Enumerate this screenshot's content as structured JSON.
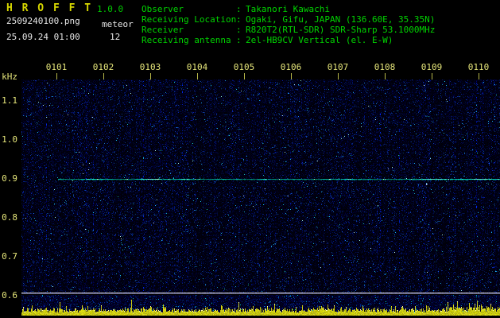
{
  "header": {
    "app_title": "H R O F F T",
    "version": "1.0.0",
    "filename": "2509240100.png",
    "mode": "meteor",
    "datetime": "25.09.24 01:00",
    "echo_count": "12",
    "separator": ":",
    "info": [
      {
        "label": "Observer",
        "value": "Takanori Kawachi"
      },
      {
        "label": "Receiving Location",
        "value": "Ogaki, Gifu, JAPAN (136.60E, 35.35N)"
      },
      {
        "label": "Receiver",
        "value": "R820T2(RTL-SDR) SDR-Sharp 53.1000MHz"
      },
      {
        "label": "Receiving antenna",
        "value": "2el-HB9CV Vertical (el. E-W)"
      }
    ]
  },
  "chart_data": {
    "type": "heatmap",
    "ylabel": "kHz",
    "x_ticks": [
      "0101",
      "0102",
      "0103",
      "0104",
      "0105",
      "0106",
      "0107",
      "0108",
      "0109",
      "0110"
    ],
    "y_ticks": [
      "1.1",
      "1.0",
      "0.9",
      "0.8",
      "0.7",
      "0.6"
    ],
    "y_range_khz": [
      0.59,
      1.15
    ],
    "carrier_line_khz": 0.9,
    "grid": false,
    "legend_position": "none"
  },
  "colors": {
    "background": "#000000",
    "title_text": "#d8d800",
    "version_text": "#00c800",
    "info_text": "#00d400",
    "white_text": "#e6e6e6",
    "axis_text": "#e6e67a",
    "carrier_line": "#00e6c8",
    "noise_strip": "#e6e600",
    "axis_line": "#d0d0e0",
    "noise_background": "#000a28"
  }
}
